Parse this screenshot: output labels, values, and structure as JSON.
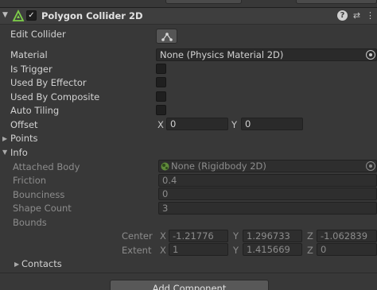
{
  "component": {
    "title": "Polygon Collider 2D",
    "enabled_check": "✓",
    "fold_glyph": "▼",
    "header_icons": [
      "help-icon",
      "preset-icon",
      "context-menu-icon"
    ]
  },
  "labels": {
    "edit_collider": "Edit Collider",
    "material": "Material",
    "is_trigger": "Is Trigger",
    "used_by_effector": "Used By Effector",
    "used_by_composite": "Used By Composite",
    "auto_tiling": "Auto Tiling",
    "offset": "Offset",
    "points": "Points",
    "info": "Info",
    "attached_body": "Attached Body",
    "friction": "Friction",
    "bounciness": "Bounciness",
    "shape_count": "Shape Count",
    "bounds": "Bounds",
    "center": "Center",
    "extent": "Extent",
    "contacts": "Contacts"
  },
  "values": {
    "material": "None (Physics Material 2D)",
    "offset_x": "0",
    "offset_y": "0",
    "attached_body": "None (Rigidbody 2D)",
    "friction": "0.4",
    "bounciness": "0",
    "shape_count": "3",
    "center_x": "-1.21776",
    "center_y": "1.296733",
    "center_z": "-1.062839",
    "extent_x": "1",
    "extent_y": "1.415669",
    "extent_z": "0"
  },
  "axes": {
    "x": "X",
    "y": "Y",
    "z": "Z"
  },
  "glyphs": {
    "collapsed": "▶",
    "expanded": "▼",
    "help": "?",
    "preset": "⇄",
    "menu": "⋮"
  },
  "add_component": "Add Component"
}
